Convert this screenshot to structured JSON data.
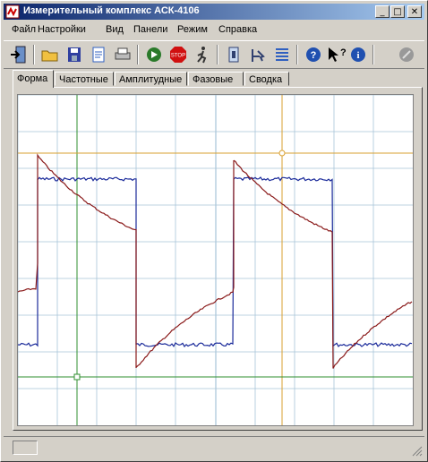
{
  "window": {
    "title": "Измерительный комплекс АСК-4106",
    "controls": {
      "minimize": "_",
      "maximize": "□",
      "close": "✕"
    }
  },
  "menu": [
    {
      "label": "Файл"
    },
    {
      "label": "Настройки"
    },
    {
      "label": "Вид"
    },
    {
      "label": "Панели"
    },
    {
      "label": "Режим"
    },
    {
      "label": "Справка"
    }
  ],
  "toolbar": [
    {
      "name": "exit-icon"
    },
    {
      "name": "open-folder-icon"
    },
    {
      "name": "save-icon"
    },
    {
      "name": "page-icon"
    },
    {
      "name": "print-icon"
    },
    {
      "name": "run-icon"
    },
    {
      "name": "stop-icon"
    },
    {
      "name": "single-run-icon"
    },
    {
      "name": "settings-panel-icon"
    },
    {
      "name": "cursor-tool-icon"
    },
    {
      "name": "channels-icon"
    },
    {
      "name": "help-icon"
    },
    {
      "name": "context-help-icon"
    },
    {
      "name": "info-icon"
    },
    {
      "name": "disabled-icon"
    }
  ],
  "tabs": [
    {
      "label": "Форма",
      "active": true
    },
    {
      "label": "Частотные"
    },
    {
      "label": "Амплитудные"
    },
    {
      "label": "Фазовые"
    },
    {
      "label": "Сводка"
    }
  ],
  "scope": {
    "grid_color": "#a8c4d8",
    "cursor_colors": {
      "vertical_1": "#2f8f2f",
      "vertical_2": "#d9a030",
      "horizontal_1": "#d9a030",
      "horizontal_2": "#2f8f2f"
    },
    "series": [
      {
        "color": "#1a2a9a",
        "shape": "square-wave"
      },
      {
        "color": "#8a1a1a",
        "shape": "exponential-charge-discharge"
      }
    ]
  },
  "status": {
    "text": ""
  }
}
